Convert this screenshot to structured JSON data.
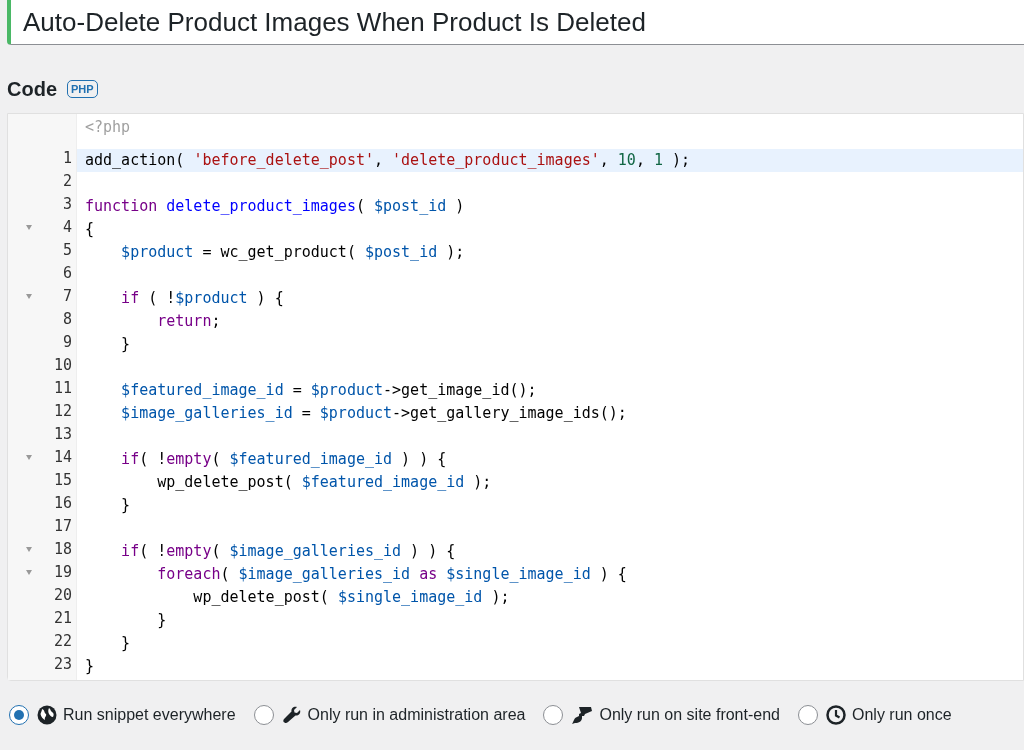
{
  "title_field": {
    "value": "Auto-Delete Product Images When Product Is Deleted"
  },
  "code_section": {
    "heading": "Code",
    "language_badge": "PHP"
  },
  "editor": {
    "preamble": "<?php",
    "lines": [
      {
        "number": "1",
        "foldable": false,
        "active": true,
        "tokens": [
          {
            "kind": "plain",
            "text": "add_action( "
          },
          {
            "kind": "string",
            "text": "'before_delete_post'"
          },
          {
            "kind": "plain",
            "text": ", "
          },
          {
            "kind": "string",
            "text": "'delete_product_images'"
          },
          {
            "kind": "plain",
            "text": ", "
          },
          {
            "kind": "number",
            "text": "10"
          },
          {
            "kind": "plain",
            "text": ", "
          },
          {
            "kind": "number",
            "text": "1"
          },
          {
            "kind": "plain",
            "text": " );"
          }
        ]
      },
      {
        "number": "2",
        "foldable": false,
        "active": false
      },
      {
        "number": "3",
        "foldable": false,
        "active": false,
        "tokens": [
          {
            "kind": "keyword",
            "text": "function "
          },
          {
            "kind": "definition",
            "text": "delete_product_images"
          },
          {
            "kind": "plain",
            "text": "( "
          },
          {
            "kind": "variable",
            "text": "$post_id"
          },
          {
            "kind": "plain",
            "text": " )"
          }
        ]
      },
      {
        "number": "4",
        "foldable": true,
        "active": false,
        "tokens": [
          {
            "kind": "plain",
            "text": "{"
          }
        ]
      },
      {
        "number": "5",
        "foldable": false,
        "active": false,
        "tokens": [
          {
            "kind": "variable",
            "text": "    $product"
          },
          {
            "kind": "plain",
            "text": " = wc_get_product( "
          },
          {
            "kind": "variable",
            "text": "$post_id"
          },
          {
            "kind": "plain",
            "text": " );"
          }
        ]
      },
      {
        "number": "6",
        "foldable": false,
        "active": false
      },
      {
        "number": "7",
        "foldable": true,
        "active": false,
        "tokens": [
          {
            "kind": "keyword",
            "text": "    if"
          },
          {
            "kind": "plain",
            "text": " ( !"
          },
          {
            "kind": "variable",
            "text": "$product"
          },
          {
            "kind": "plain",
            "text": " ) {"
          }
        ]
      },
      {
        "number": "8",
        "foldable": false,
        "active": false,
        "tokens": [
          {
            "kind": "keyword",
            "text": "        return"
          },
          {
            "kind": "plain",
            "text": ";"
          }
        ]
      },
      {
        "number": "9",
        "foldable": false,
        "active": false,
        "tokens": [
          {
            "kind": "plain",
            "text": "    }"
          }
        ]
      },
      {
        "number": "10",
        "foldable": false,
        "active": false
      },
      {
        "number": "11",
        "foldable": false,
        "active": false,
        "tokens": [
          {
            "kind": "variable",
            "text": "    $featured_image_id"
          },
          {
            "kind": "plain",
            "text": " = "
          },
          {
            "kind": "variable",
            "text": "$product"
          },
          {
            "kind": "plain",
            "text": "->get_image_id();"
          }
        ]
      },
      {
        "number": "12",
        "foldable": false,
        "active": false,
        "tokens": [
          {
            "kind": "variable",
            "text": "    $image_galleries_id"
          },
          {
            "kind": "plain",
            "text": " = "
          },
          {
            "kind": "variable",
            "text": "$product"
          },
          {
            "kind": "plain",
            "text": "->get_gallery_image_ids();"
          }
        ]
      },
      {
        "number": "13",
        "foldable": false,
        "active": false
      },
      {
        "number": "14",
        "foldable": true,
        "active": false,
        "tokens": [
          {
            "kind": "keyword",
            "text": "    if"
          },
          {
            "kind": "plain",
            "text": "( !"
          },
          {
            "kind": "keyword",
            "text": "empty"
          },
          {
            "kind": "plain",
            "text": "( "
          },
          {
            "kind": "variable",
            "text": "$featured_image_id"
          },
          {
            "kind": "plain",
            "text": " ) ) {"
          }
        ]
      },
      {
        "number": "15",
        "foldable": false,
        "active": false,
        "tokens": [
          {
            "kind": "plain",
            "text": "        wp_delete_post( "
          },
          {
            "kind": "variable",
            "text": "$featured_image_id"
          },
          {
            "kind": "plain",
            "text": " );"
          }
        ]
      },
      {
        "number": "16",
        "foldable": false,
        "active": false,
        "tokens": [
          {
            "kind": "plain",
            "text": "    }"
          }
        ]
      },
      {
        "number": "17",
        "foldable": false,
        "active": false
      },
      {
        "number": "18",
        "foldable": true,
        "active": false,
        "tokens": [
          {
            "kind": "keyword",
            "text": "    if"
          },
          {
            "kind": "plain",
            "text": "( !"
          },
          {
            "kind": "keyword",
            "text": "empty"
          },
          {
            "kind": "plain",
            "text": "( "
          },
          {
            "kind": "variable",
            "text": "$image_galleries_id"
          },
          {
            "kind": "plain",
            "text": " ) ) {"
          }
        ]
      },
      {
        "number": "19",
        "foldable": true,
        "active": false,
        "tokens": [
          {
            "kind": "keyword",
            "text": "        foreach"
          },
          {
            "kind": "plain",
            "text": "( "
          },
          {
            "kind": "variable",
            "text": "$image_galleries_id"
          },
          {
            "kind": "keyword",
            "text": " as "
          },
          {
            "kind": "variable",
            "text": "$single_image_id"
          },
          {
            "kind": "plain",
            "text": " ) {"
          }
        ]
      },
      {
        "number": "20",
        "foldable": false,
        "active": false,
        "tokens": [
          {
            "kind": "plain",
            "text": "            wp_delete_post( "
          },
          {
            "kind": "variable",
            "text": "$single_image_id"
          },
          {
            "kind": "plain",
            "text": " );"
          }
        ]
      },
      {
        "number": "21",
        "foldable": false,
        "active": false,
        "tokens": [
          {
            "kind": "plain",
            "text": "        }"
          }
        ]
      },
      {
        "number": "22",
        "foldable": false,
        "active": false,
        "tokens": [
          {
            "kind": "plain",
            "text": "    }"
          }
        ]
      },
      {
        "number": "23",
        "foldable": false,
        "active": false,
        "tokens": [
          {
            "kind": "plain",
            "text": "}"
          }
        ]
      }
    ]
  },
  "run_options": [
    {
      "kind": "globe",
      "label": "Run snippet everywhere",
      "selected": true
    },
    {
      "kind": "wrench",
      "label": "Only run in administration area",
      "selected": false
    },
    {
      "kind": "brush",
      "label": "Only run on site front-end",
      "selected": false
    },
    {
      "kind": "clock",
      "label": "Only run once",
      "selected": false
    }
  ]
}
